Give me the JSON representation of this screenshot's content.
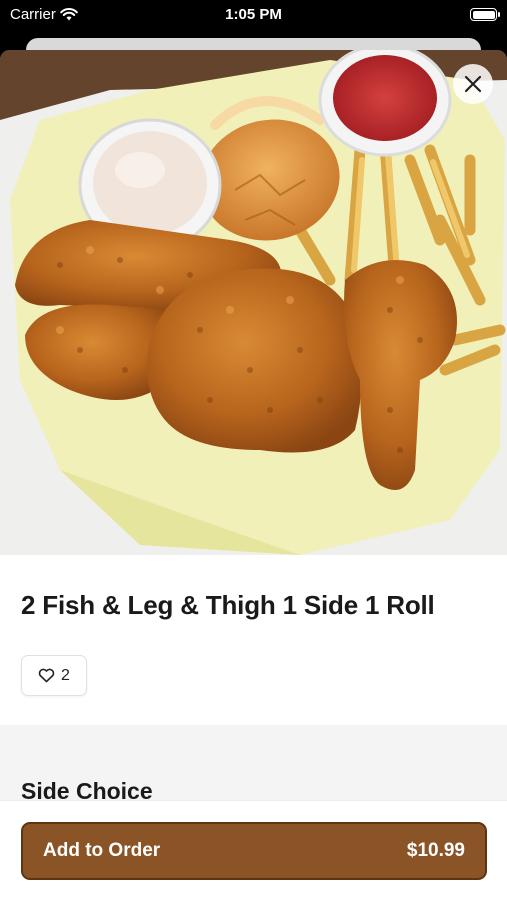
{
  "status_bar": {
    "carrier": "Carrier",
    "time": "1:05 PM"
  },
  "item": {
    "image_icon": "fried-chicken-basket-photo",
    "title": "2 Fish & Leg & Thigh 1 Side 1 Roll",
    "likes": "2"
  },
  "sections": [
    {
      "title": "Side Choice"
    }
  ],
  "footer": {
    "add_label": "Add to Order",
    "price": "$10.99"
  },
  "colors": {
    "accent": "#8b5426",
    "accent_border": "#5e3411",
    "section_bg": "#f4f4f4"
  }
}
